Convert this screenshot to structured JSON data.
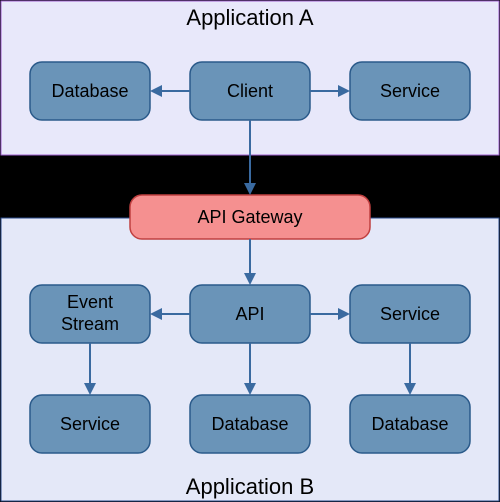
{
  "appA": {
    "title": "Application A",
    "nodes": {
      "database": "Database",
      "client": "Client",
      "service": "Service"
    }
  },
  "gateway": "API Gateway",
  "appB": {
    "title": "Application B",
    "nodes": {
      "eventStream1": "Event",
      "eventStream2": "Stream",
      "api": "API",
      "serviceTop": "Service",
      "serviceBottom": "Service",
      "databaseMid": "Database",
      "databaseRight": "Database"
    }
  },
  "colors": {
    "nodeBlue": "#6a94b8",
    "nodeRed": "#f59090",
    "regionA": "#e8e8fa",
    "regionB": "#e4e8f8",
    "arrow": "#3a6aa0"
  }
}
